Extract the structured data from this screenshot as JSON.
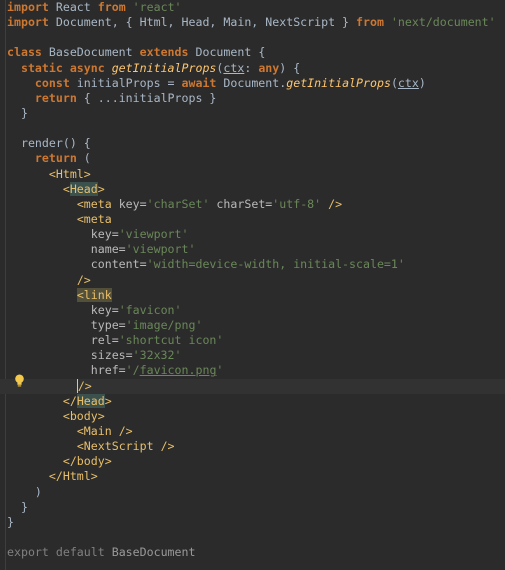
{
  "lines": [
    {
      "highlight": false,
      "tokens": [
        {
          "t": "import",
          "c": "keyword"
        },
        {
          "t": " React ",
          "c": "plain"
        },
        {
          "t": "from",
          "c": "keyword"
        },
        {
          "t": " ",
          "c": "plain"
        },
        {
          "t": "'react'",
          "c": "string"
        }
      ]
    },
    {
      "highlight": false,
      "tokens": [
        {
          "t": "import",
          "c": "keyword"
        },
        {
          "t": " Document, { Html, Head, Main, NextScript } ",
          "c": "plain"
        },
        {
          "t": "from",
          "c": "keyword"
        },
        {
          "t": " ",
          "c": "plain"
        },
        {
          "t": "'next/document'",
          "c": "string"
        }
      ]
    },
    {
      "highlight": false,
      "tokens": []
    },
    {
      "highlight": false,
      "tokens": [
        {
          "t": "class",
          "c": "keyword"
        },
        {
          "t": " BaseDocument ",
          "c": "plain"
        },
        {
          "t": "extends",
          "c": "keyword"
        },
        {
          "t": " Document {",
          "c": "plain"
        }
      ]
    },
    {
      "highlight": false,
      "tokens": [
        {
          "t": "  static async ",
          "c": "keyword"
        },
        {
          "t": "getInitialProps",
          "c": "func"
        },
        {
          "t": "(",
          "c": "plain"
        },
        {
          "t": "ctx",
          "c": "param"
        },
        {
          "t": ": ",
          "c": "plain"
        },
        {
          "t": "any",
          "c": "keyword"
        },
        {
          "t": ") {",
          "c": "plain"
        }
      ]
    },
    {
      "highlight": false,
      "tokens": [
        {
          "t": "    const",
          "c": "keyword"
        },
        {
          "t": " initialProps = ",
          "c": "plain"
        },
        {
          "t": "await",
          "c": "keyword"
        },
        {
          "t": " Document.",
          "c": "plain"
        },
        {
          "t": "getInitialProps",
          "c": "func"
        },
        {
          "t": "(",
          "c": "plain"
        },
        {
          "t": "ctx",
          "c": "param"
        },
        {
          "t": ")",
          "c": "plain"
        }
      ]
    },
    {
      "highlight": false,
      "tokens": [
        {
          "t": "    return",
          "c": "keyword"
        },
        {
          "t": " { ...initialProps }",
          "c": "plain"
        }
      ]
    },
    {
      "highlight": false,
      "tokens": [
        {
          "t": "  }",
          "c": "plain"
        }
      ]
    },
    {
      "highlight": false,
      "tokens": []
    },
    {
      "highlight": false,
      "tokens": [
        {
          "t": "  render() {",
          "c": "plain"
        }
      ]
    },
    {
      "highlight": false,
      "tokens": [
        {
          "t": "    return",
          "c": "keyword"
        },
        {
          "t": " (",
          "c": "plain"
        }
      ]
    },
    {
      "highlight": false,
      "tokens": [
        {
          "t": "      ",
          "c": "plain"
        },
        {
          "t": "<Html>",
          "c": "tag"
        }
      ]
    },
    {
      "highlight": false,
      "tokens": [
        {
          "t": "        ",
          "c": "plain"
        },
        {
          "t": "<",
          "c": "tag"
        },
        {
          "t": "Head",
          "c": "tag-hl"
        },
        {
          "t": ">",
          "c": "tag"
        }
      ]
    },
    {
      "highlight": false,
      "tokens": [
        {
          "t": "          ",
          "c": "plain"
        },
        {
          "t": "<meta ",
          "c": "tag"
        },
        {
          "t": "key=",
          "c": "attr"
        },
        {
          "t": "'charSet'",
          "c": "string"
        },
        {
          "t": " charSet=",
          "c": "attr"
        },
        {
          "t": "'utf-8'",
          "c": "string"
        },
        {
          "t": " />",
          "c": "tag"
        }
      ]
    },
    {
      "highlight": false,
      "tokens": [
        {
          "t": "          ",
          "c": "plain"
        },
        {
          "t": "<meta",
          "c": "tag"
        }
      ]
    },
    {
      "highlight": false,
      "tokens": [
        {
          "t": "            key=",
          "c": "attr"
        },
        {
          "t": "'viewport'",
          "c": "string"
        }
      ]
    },
    {
      "highlight": false,
      "tokens": [
        {
          "t": "            name=",
          "c": "attr"
        },
        {
          "t": "'viewport'",
          "c": "string"
        }
      ]
    },
    {
      "highlight": false,
      "tokens": [
        {
          "t": "            content=",
          "c": "attr"
        },
        {
          "t": "'width=device-width, initial-scale=1'",
          "c": "string"
        }
      ]
    },
    {
      "highlight": false,
      "tokens": [
        {
          "t": "          ",
          "c": "plain"
        },
        {
          "t": "/>",
          "c": "tag"
        }
      ]
    },
    {
      "highlight": false,
      "tokens": [
        {
          "t": "          ",
          "c": "plain"
        },
        {
          "t": "<link",
          "c": "tag-warn"
        }
      ]
    },
    {
      "highlight": false,
      "tokens": [
        {
          "t": "            key=",
          "c": "attr"
        },
        {
          "t": "'favicon'",
          "c": "string"
        }
      ]
    },
    {
      "highlight": false,
      "tokens": [
        {
          "t": "            type=",
          "c": "attr"
        },
        {
          "t": "'image/png'",
          "c": "string"
        }
      ]
    },
    {
      "highlight": false,
      "tokens": [
        {
          "t": "            rel=",
          "c": "attr"
        },
        {
          "t": "'shortcut icon'",
          "c": "string"
        }
      ]
    },
    {
      "highlight": false,
      "tokens": [
        {
          "t": "            sizes=",
          "c": "attr"
        },
        {
          "t": "'32x32'",
          "c": "string"
        }
      ]
    },
    {
      "highlight": false,
      "tokens": [
        {
          "t": "            href=",
          "c": "attr"
        },
        {
          "t": "'/",
          "c": "string"
        },
        {
          "t": "favicon.png",
          "c": "string-ul"
        },
        {
          "t": "'",
          "c": "string"
        }
      ]
    },
    {
      "highlight": true,
      "tokens": [
        {
          "t": "          ",
          "c": "plain"
        },
        {
          "t": "/>",
          "c": "tag-caret"
        }
      ]
    },
    {
      "highlight": false,
      "tokens": [
        {
          "t": "        ",
          "c": "plain"
        },
        {
          "t": "</",
          "c": "tag"
        },
        {
          "t": "Head",
          "c": "tag-hl"
        },
        {
          "t": ">",
          "c": "tag"
        }
      ]
    },
    {
      "highlight": false,
      "tokens": [
        {
          "t": "        ",
          "c": "plain"
        },
        {
          "t": "<body>",
          "c": "tag"
        }
      ]
    },
    {
      "highlight": false,
      "tokens": [
        {
          "t": "          ",
          "c": "plain"
        },
        {
          "t": "<Main />",
          "c": "tag"
        }
      ]
    },
    {
      "highlight": false,
      "tokens": [
        {
          "t": "          ",
          "c": "plain"
        },
        {
          "t": "<NextScript />",
          "c": "tag"
        }
      ]
    },
    {
      "highlight": false,
      "tokens": [
        {
          "t": "        ",
          "c": "plain"
        },
        {
          "t": "</body>",
          "c": "tag"
        }
      ]
    },
    {
      "highlight": false,
      "tokens": [
        {
          "t": "      ",
          "c": "plain"
        },
        {
          "t": "</Html>",
          "c": "tag"
        }
      ]
    },
    {
      "highlight": false,
      "tokens": [
        {
          "t": "    )",
          "c": "plain"
        }
      ]
    },
    {
      "highlight": false,
      "tokens": [
        {
          "t": "  }",
          "c": "plain"
        }
      ]
    },
    {
      "highlight": false,
      "tokens": [
        {
          "t": "}",
          "c": "plain"
        }
      ]
    },
    {
      "highlight": false,
      "tokens": []
    },
    {
      "highlight": false,
      "tokens": [
        {
          "t": "export default",
          "c": "comment"
        },
        {
          "t": " BaseDocument",
          "c": "plain-dim"
        }
      ]
    }
  ],
  "intention_icon": "lightbulb-icon",
  "colors": {
    "background": "#2b2b2b",
    "keyword": "#cc7832",
    "string": "#6a8759",
    "function": "#ffc66d",
    "tag": "#e8bf6a",
    "plain": "#a9b7c6"
  }
}
